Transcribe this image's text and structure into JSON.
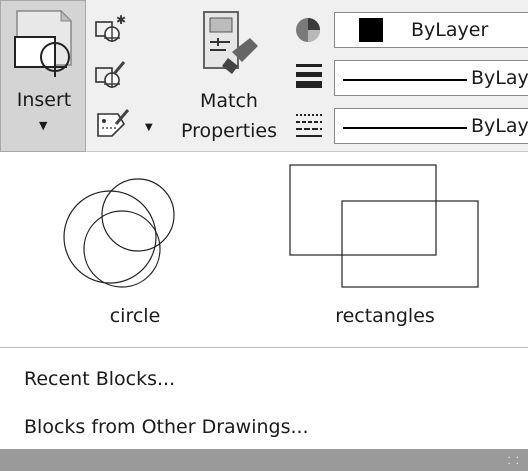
{
  "ribbon": {
    "insert_label": "Insert",
    "match_label_line1": "Match",
    "match_label_line2": "Properties",
    "color_value": "ByLayer",
    "lineweight_value": "ByLay",
    "linetype_value": "ByLay",
    "icons": {
      "insert": "insert-block-icon",
      "create": "create-block-icon",
      "edit": "edit-block-icon",
      "attributes": "edit-attributes-icon",
      "match": "match-properties-icon",
      "color": "color-wheel-icon",
      "lineweight": "lineweight-icon",
      "linetype": "linetype-icon"
    }
  },
  "gallery": {
    "items": [
      {
        "label": "circle"
      },
      {
        "label": "rectangles"
      }
    ]
  },
  "menu": {
    "recent": "Recent Blocks...",
    "other": "Blocks from Other Drawings..."
  },
  "colors": {
    "ribbon_bg": "#f0f0f0",
    "insert_bg": "#d4d4d4",
    "statusbar": "#9a9a9a"
  }
}
